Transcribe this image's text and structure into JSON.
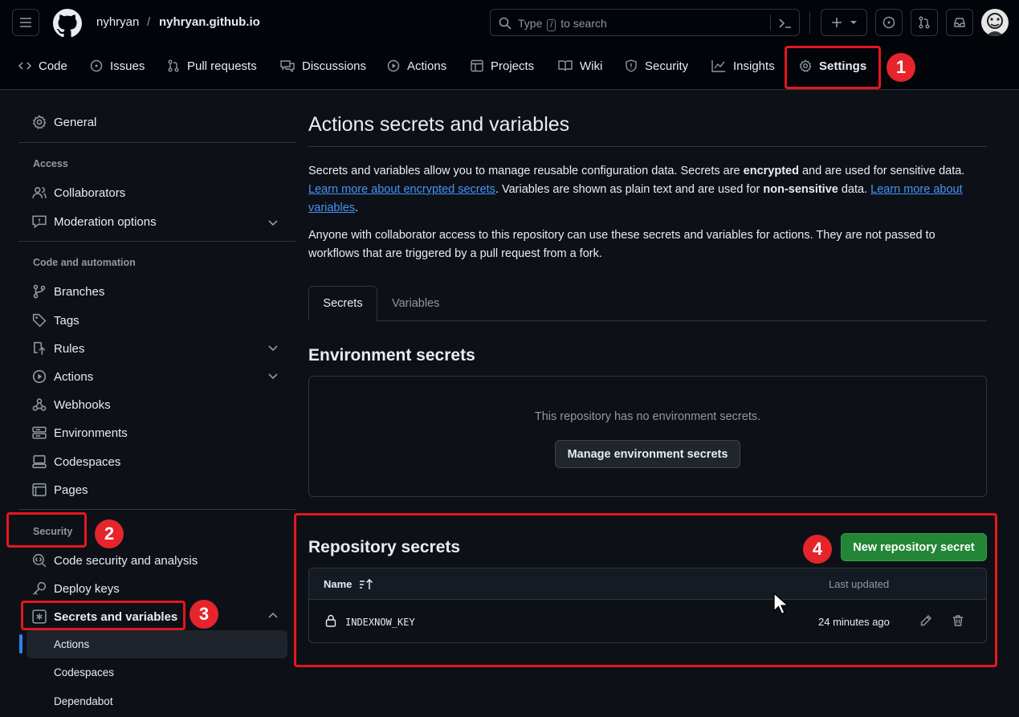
{
  "header": {
    "owner": "nyhryan",
    "separator": "/",
    "repo": "nyhryan.github.io",
    "search_type": "Type",
    "search_key": "/",
    "search_tail": "to search"
  },
  "tabs": [
    {
      "label": "Code",
      "icon": "code-icon"
    },
    {
      "label": "Issues",
      "icon": "issue-icon"
    },
    {
      "label": "Pull requests",
      "icon": "pull-request-icon"
    },
    {
      "label": "Discussions",
      "icon": "discussion-icon"
    },
    {
      "label": "Actions",
      "icon": "play-icon"
    },
    {
      "label": "Projects",
      "icon": "table-icon"
    },
    {
      "label": "Wiki",
      "icon": "book-icon"
    },
    {
      "label": "Security",
      "icon": "shield-icon"
    },
    {
      "label": "Insights",
      "icon": "graph-icon"
    },
    {
      "label": "Settings",
      "icon": "gear-icon",
      "active": true
    }
  ],
  "annotations": [
    "1",
    "2",
    "3",
    "4"
  ],
  "sidebar": {
    "general": "General",
    "access_heading": "Access",
    "collaborators": "Collaborators",
    "moderation": "Moderation options",
    "code_heading": "Code and automation",
    "branches": "Branches",
    "tags": "Tags",
    "rules": "Rules",
    "actions": "Actions",
    "webhooks": "Webhooks",
    "environments": "Environments",
    "codespaces": "Codespaces",
    "pages": "Pages",
    "security_heading": "Security",
    "code_security": "Code security and analysis",
    "deploy_keys": "Deploy keys",
    "secrets": "Secrets and variables",
    "sub_actions": "Actions",
    "sub_codespaces": "Codespaces",
    "sub_dependabot": "Dependabot"
  },
  "main": {
    "title": "Actions secrets and variables",
    "p1_a": "Secrets and variables allow you to manage reusable configuration data. Secrets are ",
    "p1_b": "encrypted",
    "p1_c": " and are used for sensitive data. ",
    "p1_link1": "Learn more about encrypted secrets",
    "p1_d": ". Variables are shown as plain text and are used for ",
    "p1_e": "non-sensitive",
    "p1_f": " data. ",
    "p1_link2": "Learn more about variables",
    "p1_g": ".",
    "p2": "Anyone with collaborator access to this repository can use these secrets and variables for actions. They are not passed to workflows that are triggered by a pull request from a fork.",
    "tab_secrets": "Secrets",
    "tab_variables": "Variables",
    "env_title": "Environment secrets",
    "env_empty": "This repository has no environment secrets.",
    "env_button": "Manage environment secrets",
    "repo_title": "Repository secrets",
    "new_button": "New repository secret",
    "col_name": "Name",
    "col_updated": "Last updated",
    "secret_name": "INDEXNOW_KEY",
    "secret_updated": "24 minutes ago"
  },
  "colors": {
    "accent": "#f78166",
    "primary_button": "#238636",
    "link": "#4493f8",
    "highlight": "#e5171e"
  }
}
